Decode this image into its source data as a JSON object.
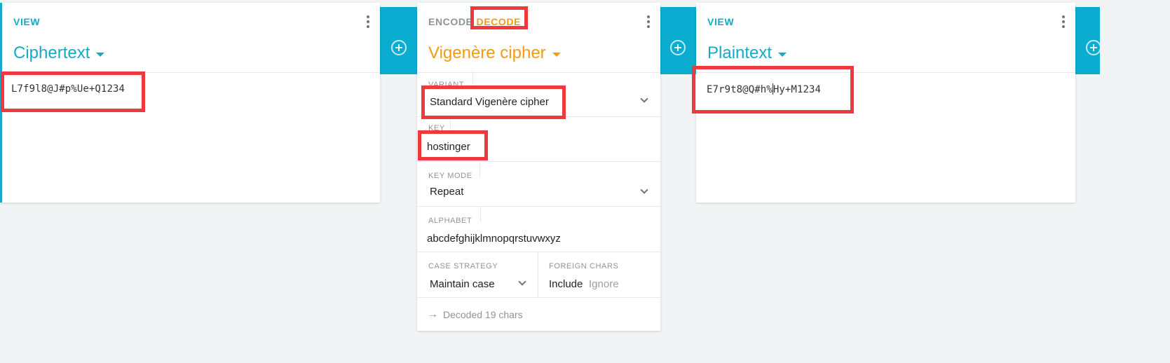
{
  "input_card": {
    "mode_label": "VIEW",
    "title": "Ciphertext",
    "content": "L7f9l8@J#p%Ue+Q1234"
  },
  "operation_card": {
    "encode_label": "ENCODE",
    "decode_label": "DECODE",
    "title": "Vigenère cipher",
    "fields": {
      "variant": {
        "label": "VARIANT",
        "value": "Standard Vigenère cipher"
      },
      "key": {
        "label": "KEY",
        "value": "hostinger"
      },
      "key_mode": {
        "label": "KEY MODE",
        "value": "Repeat"
      },
      "alphabet": {
        "label": "ALPHABET",
        "value": "abcdefghijklmnopqrstuvwxyz"
      },
      "case_strategy": {
        "label": "CASE STRATEGY",
        "value": "Maintain case"
      },
      "foreign_chars": {
        "label": "FOREIGN CHARS",
        "options": [
          "Include",
          "Ignore"
        ],
        "selected": "Include"
      }
    },
    "status": "Decoded 19 chars"
  },
  "output_card": {
    "mode_label": "VIEW",
    "title": "Plaintext",
    "content_before_cursor": "E7r9t8@Q#h%",
    "content_after_cursor": "Hy+M1234"
  },
  "colors": {
    "accent_cyan": "#16a9c8",
    "accent_orange": "#f49a14",
    "add_strip_teal": "#0aadd0",
    "highlight_red": "#ee3a3f"
  },
  "icons": {
    "kebab": "more-vertical-icon",
    "add": "add-circle-icon",
    "dropdown": "chevron-down-icon",
    "status": "arrow-right-icon"
  }
}
